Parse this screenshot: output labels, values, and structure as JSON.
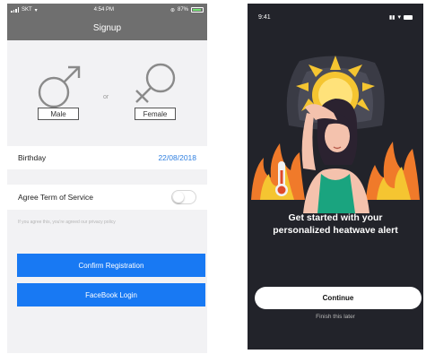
{
  "signup": {
    "status": {
      "carrier": "SKT",
      "time": "4:54 PM",
      "battery": "87%"
    },
    "title": "Signup",
    "male_label": "Male",
    "or_label": "or",
    "female_label": "Female",
    "birthday_label": "Birthday",
    "birthday_value": "22/08/2018",
    "agree_label": "Agree Term of Service",
    "agree_on": false,
    "hint": "If you agree this, you're agreed our privacy policy",
    "confirm_label": "Confirm Registration",
    "facebook_label": "FaceBook Login",
    "colors": {
      "header": "#6f6f6f",
      "accent": "#1879f3",
      "date": "#2f7fe0"
    }
  },
  "heatwave": {
    "status": {
      "time": "9:41"
    },
    "headline_line1": "Get started with your",
    "headline_line2": "personalized heatwave alert",
    "continue_label": "Continue",
    "finish_label": "Finish this later",
    "colors": {
      "background": "#22232a",
      "sun": "#f5c531",
      "fire": "#f07a2a",
      "shirt": "#1aa47f"
    }
  }
}
